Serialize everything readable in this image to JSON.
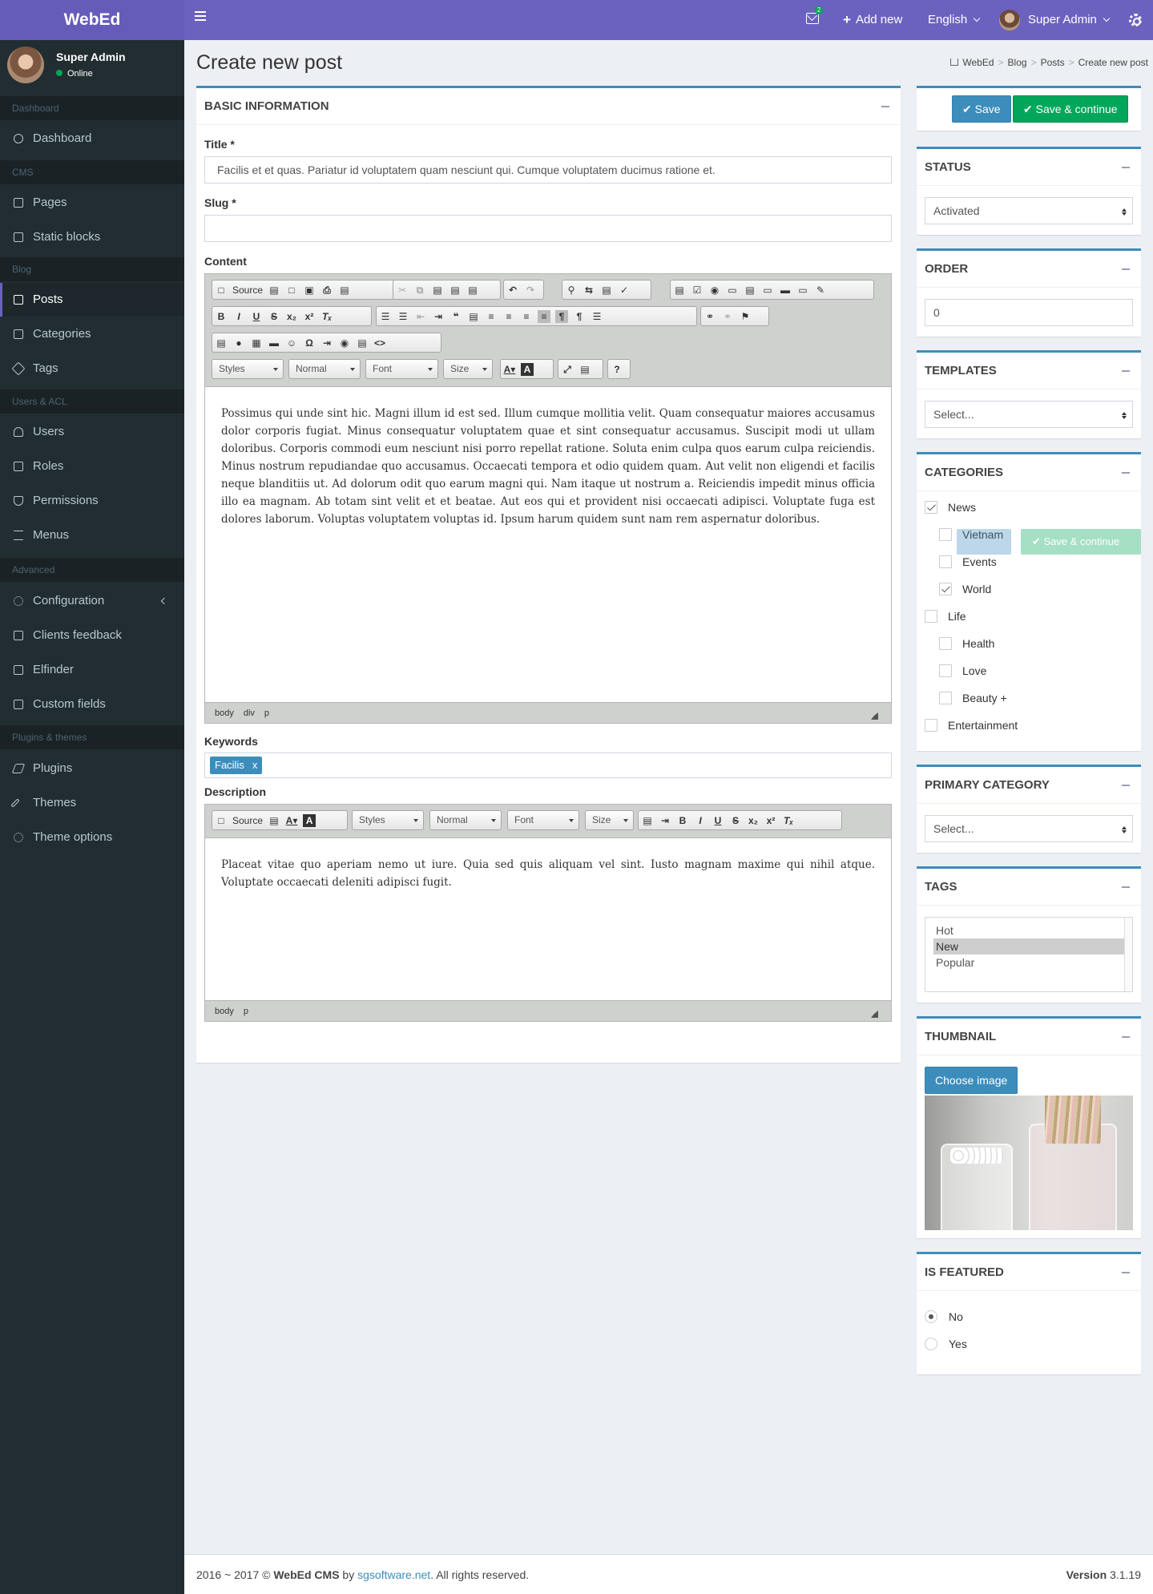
{
  "topbar": {
    "logo": "WebEd",
    "notif_count": "2",
    "add_new": "Add new",
    "language": "English",
    "user": "Super Admin"
  },
  "sidebar": {
    "user_name": "Super Admin",
    "user_status": "Online",
    "sections": {
      "dashboard": "Dashboard",
      "cms": "CMS",
      "blog": "Blog",
      "users": "Users & ACL",
      "advanced": "Advanced",
      "plugins": "Plugins & themes"
    },
    "items": {
      "dashboard": "Dashboard",
      "pages": "Pages",
      "static_blocks": "Static blocks",
      "posts": "Posts",
      "categories": "Categories",
      "tags": "Tags",
      "users": "Users",
      "roles": "Roles",
      "permissions": "Permissions",
      "menus": "Menus",
      "configuration": "Configuration",
      "clients_feedback": "Clients feedback",
      "elfinder": "Elfinder",
      "custom_fields": "Custom fields",
      "plugins": "Plugins",
      "themes": "Themes",
      "theme_options": "Theme options"
    }
  },
  "page": {
    "title": "Create new post",
    "breadcrumb": [
      "WebEd",
      "Blog",
      "Posts",
      "Create new post"
    ]
  },
  "basic": {
    "header": "Basic information",
    "title_label": "Title *",
    "title_value": "Facilis et et quas. Pariatur id voluptatem quam nesciunt qui. Cumque voluptatem ducimus ratione et.",
    "slug_label": "Slug *",
    "slug_value": "",
    "content_label": "Content",
    "content_text": "Possimus qui unde sint hic. Magni illum id est sed. Illum cumque mollitia velit. Quam consequatur maiores accusamus dolor corporis fugiat. Minus consequatur voluptatem quae et sint consequatur accusamus. Suscipit modi ut ullam doloribus. Corporis commodi eum nesciunt nisi porro repellat ratione. Soluta enim culpa quos earum culpa reiciendis. Minus nostrum repudiandae quo accusamus. Occaecati tempora et odio quidem quam. Aut velit non eligendi et facilis neque blanditiis ut. Ad dolorum odit quo earum magni qui. Nam itaque ut nostrum a. Reiciendis impedit minus officia illo ea magnam. Ab totam sint velit et et beatae. Aut eos qui et provident nisi occaecati adipisci. Voluptate fuga est dolores laborum. Voluptas voluptatem voluptas id. Ipsum harum quidem sunt nam rem aspernatur doloribus.",
    "content_path": [
      "body",
      "div",
      "p"
    ],
    "keywords_label": "Keywords",
    "keyword_tag": "Facilis",
    "keyword_remove": "x",
    "description_label": "Description",
    "description_text": "Placeat vitae quo aperiam nemo ut iure. Quia sed quis aliquam vel sint. Iusto magnam maxime qui nihil atque. Voluptate occaecati deleniti adipisci fugit.",
    "description_path": [
      "body",
      "p"
    ]
  },
  "editor": {
    "source": "Source",
    "styles": "Styles",
    "format": "Normal",
    "font": "Font",
    "size": "Size",
    "help": "?"
  },
  "actions": {
    "save": "Save",
    "save_continue": "Save & continue"
  },
  "status": {
    "header": "Status",
    "value": "Activated"
  },
  "order": {
    "header": "Order",
    "value": "0"
  },
  "templates": {
    "header": "Templates",
    "value": "Select..."
  },
  "categories": {
    "header": "Categories",
    "items": [
      {
        "label": "News",
        "checked": true
      },
      {
        "label": "Vietnam",
        "checked": false
      },
      {
        "label": "Events",
        "checked": false
      },
      {
        "label": "World",
        "checked": true
      },
      {
        "label": "Life",
        "checked": false
      },
      {
        "label": "Health",
        "checked": false
      },
      {
        "label": "Love",
        "checked": false
      },
      {
        "label": "Beauty +",
        "checked": false
      },
      {
        "label": "Entertainment",
        "checked": false
      }
    ]
  },
  "primary_category": {
    "header": "Primary category",
    "value": "Select..."
  },
  "tags": {
    "header": "Tags",
    "options": [
      "Hot",
      "New",
      "Popular"
    ],
    "selected": "New"
  },
  "thumbnail": {
    "header": "Thumbnail",
    "button": "Choose image"
  },
  "featured": {
    "header": "Is featured",
    "options": [
      "No",
      "Yes"
    ],
    "selected": "No"
  },
  "footer": {
    "prefix": "2016 ~ 2017 © ",
    "brand": "WebEd CMS",
    "by": " by ",
    "link": "sgsoftware.net",
    "suffix": ". All rights reserved.",
    "version_label": "Version",
    "version": "3.1.19"
  },
  "colors": {
    "topbar": "#6b62c0",
    "sidebar": "#222d32",
    "primary": "#3c8dbc",
    "success": "#00a65a"
  }
}
